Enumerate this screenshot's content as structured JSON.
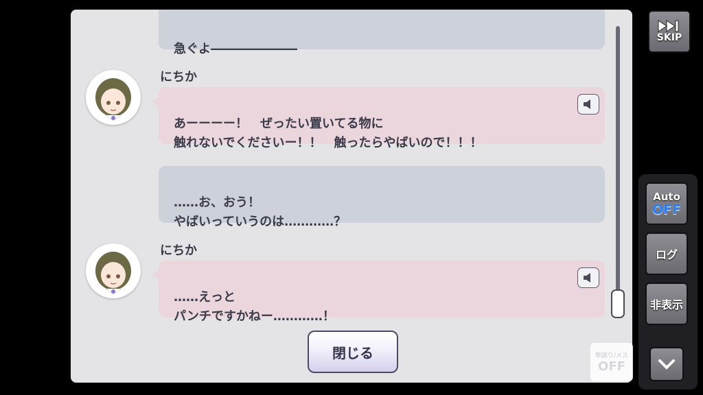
{
  "log": {
    "entries": [
      {
        "type": "player",
        "text": "急ぐよ―――――――"
      },
      {
        "type": "npc",
        "speaker": "にちか",
        "text": "あーーーー！　ぜったい置いてる物に\n触れないでくださいー！！　触ったらやばいので！！！"
      },
      {
        "type": "player",
        "text": "……お、おう！\nやばいっていうのは…………？"
      },
      {
        "type": "npc",
        "speaker": "にちか",
        "text": "……えっと\nパンチですかねー…………！"
      }
    ],
    "voice_icon": "speaker-icon",
    "close_label": "閉じる"
  },
  "sidebar": {
    "skip_label": "SKIP",
    "skip_icon": "fast-forward-icon",
    "auto_label": "Auto",
    "auto_state": "OFF",
    "log_label": "ログ",
    "hide_label": "非表示",
    "down_icon": "chevron-down-icon"
  },
  "watermark": {
    "line1": "早送り/メス",
    "line2": "OFF"
  },
  "colors": {
    "npc_bubble": "#ecd6de",
    "player_bubble": "#cdd2da",
    "panel": "#e4e4e6",
    "auto_off": "#2a7fff"
  }
}
